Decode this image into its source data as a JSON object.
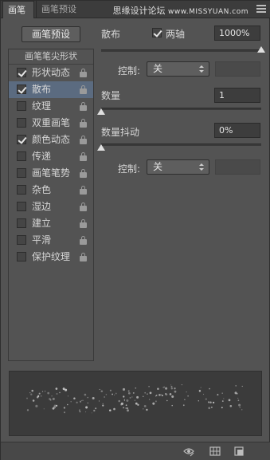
{
  "tabs": [
    {
      "label": "画笔",
      "active": true
    },
    {
      "label": "画笔预设",
      "active": false
    }
  ],
  "watermark": {
    "cn": "思缘设计论坛",
    "en": "www.MISSYUAN.com"
  },
  "presets_button": "画笔预设",
  "list": {
    "header": "画笔笔尖形状",
    "items": [
      {
        "label": "形状动态",
        "checked": true,
        "selected": false,
        "lock": true
      },
      {
        "label": "散布",
        "checked": true,
        "selected": true,
        "lock": true
      },
      {
        "label": "纹理",
        "checked": false,
        "selected": false,
        "lock": true
      },
      {
        "label": "双重画笔",
        "checked": false,
        "selected": false,
        "lock": true
      },
      {
        "label": "颜色动态",
        "checked": true,
        "selected": false,
        "lock": true
      },
      {
        "label": "传递",
        "checked": false,
        "selected": false,
        "lock": true
      },
      {
        "label": "画笔笔势",
        "checked": false,
        "selected": false,
        "lock": true
      },
      {
        "label": "杂色",
        "checked": false,
        "selected": false,
        "lock": true
      },
      {
        "label": "湿边",
        "checked": false,
        "selected": false,
        "lock": true
      },
      {
        "label": "建立",
        "checked": false,
        "selected": false,
        "lock": true
      },
      {
        "label": "平滑",
        "checked": false,
        "selected": false,
        "lock": true
      },
      {
        "label": "保护纹理",
        "checked": false,
        "selected": false,
        "lock": true
      }
    ]
  },
  "scatter": {
    "label": "散布",
    "both_axes_label": "两轴",
    "both_axes_checked": true,
    "value": "1000%",
    "slider_fraction": 1.0,
    "control_label": "控制:",
    "control_value": "关"
  },
  "count": {
    "label": "数量",
    "value": "1",
    "slider_fraction": 0.0
  },
  "count_jitter": {
    "label": "数量抖动",
    "value": "0%",
    "slider_fraction": 0.0,
    "control_label": "控制:",
    "control_value": "关"
  },
  "icons": {
    "menu": "panel-menu-icon",
    "lock": "lock-icon",
    "toggle_preview": "eye-brush-icon",
    "grid": "grid-icon",
    "new_preset": "new-preset-icon"
  },
  "colors": {
    "panel": "#535353",
    "selected_row": "#5b6b80",
    "input_bg": "#3d3d3d"
  }
}
